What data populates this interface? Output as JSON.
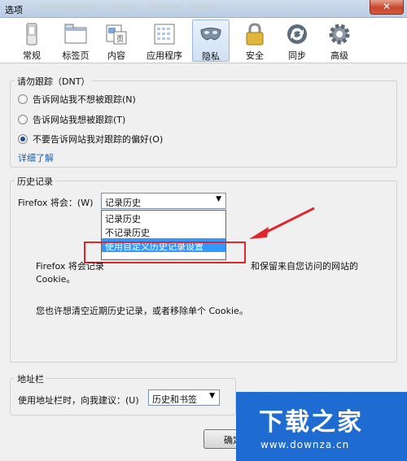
{
  "window": {
    "title": "选项"
  },
  "toolbar": {
    "items": [
      {
        "label": "常规",
        "icon": "switch-icon"
      },
      {
        "label": "标签页",
        "icon": "tabs-icon"
      },
      {
        "label": "内容",
        "icon": "content-icon"
      },
      {
        "label": "应用程序",
        "icon": "applications-icon"
      },
      {
        "label": "隐私",
        "icon": "privacy-mask-icon",
        "active": true
      },
      {
        "label": "安全",
        "icon": "lock-icon"
      },
      {
        "label": "同步",
        "icon": "sync-icon"
      },
      {
        "label": "高级",
        "icon": "gear-icon"
      }
    ]
  },
  "dnt": {
    "legend": "请勿跟踪（DNT）",
    "options": [
      {
        "label": "告诉网站我不想被跟踪(N)",
        "checked": false
      },
      {
        "label": "告诉网站我想被跟踪(T)",
        "checked": false
      },
      {
        "label": "不要告诉网站我对跟踪的偏好(O)",
        "checked": true
      }
    ],
    "learn_more": "详细了解"
  },
  "history": {
    "legend": "历史记录",
    "label": "Firefox 将会：(W)",
    "selected": "记录历史",
    "options": [
      {
        "label": "记录历史",
        "highlighted": false
      },
      {
        "label": "不记录历史",
        "highlighted": false
      },
      {
        "label": "使用自定义历史记录设置",
        "highlighted": true
      }
    ],
    "desc_line1_start": "Firefox 将会记录",
    "desc_line1_end": "和保留来自您访问的网站的",
    "desc_line2": "Cookie。",
    "desc_line3": "您也许想清空近期历史记录，或者移除单个 Cookie。"
  },
  "address_bar": {
    "legend": "地址栏",
    "label": "使用地址栏时，向我建议：(U)",
    "selected": "历史和书签"
  },
  "buttons": {
    "ok": "确定"
  },
  "watermark": {
    "logo": "下载之家",
    "url": "www.downza.cn"
  },
  "colors": {
    "highlight": "#3399ff",
    "annotation_red": "#e0262a",
    "watermark_blue": "#1e6bd1"
  }
}
